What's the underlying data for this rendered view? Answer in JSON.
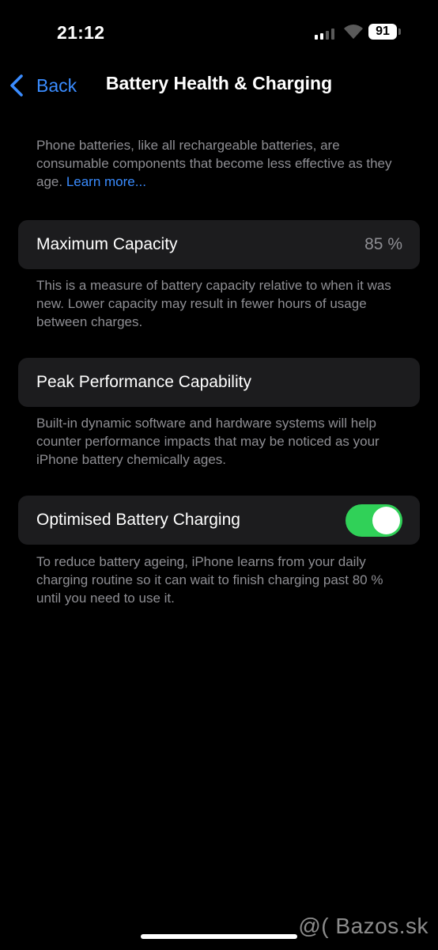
{
  "status_bar": {
    "time": "21:12",
    "battery_level": "91",
    "icons": [
      "cellular-signal-icon",
      "wifi-icon",
      "battery-icon"
    ]
  },
  "nav": {
    "back_label": "Back",
    "title": "Battery Health & Charging"
  },
  "intro": {
    "text": "Phone batteries, like all rechargeable batteries, are consumable components that become less effective as they age. ",
    "link_label": "Learn more..."
  },
  "maximum_capacity": {
    "label": "Maximum Capacity",
    "value": "85 %",
    "description": "This is a measure of battery capacity relative to when it was new. Lower capacity may result in fewer hours of usage between charges."
  },
  "peak_performance": {
    "label": "Peak Performance Capability",
    "description": "Built-in dynamic software and hardware systems will help counter performance impacts that may be noticed as your iPhone battery chemically ages."
  },
  "optimised_charging": {
    "label": "Optimised Battery Charging",
    "enabled": true,
    "description": "To reduce battery ageing, iPhone learns from your daily charging routine so it can wait to finish charging past 80 % until you need to use it."
  },
  "watermark": "@( Bazos.sk",
  "colors": {
    "background": "#000000",
    "card": "#1c1c1e",
    "accent_blue": "#3a8cff",
    "toggle_on": "#30d158",
    "secondary_text": "#8e8e93"
  }
}
